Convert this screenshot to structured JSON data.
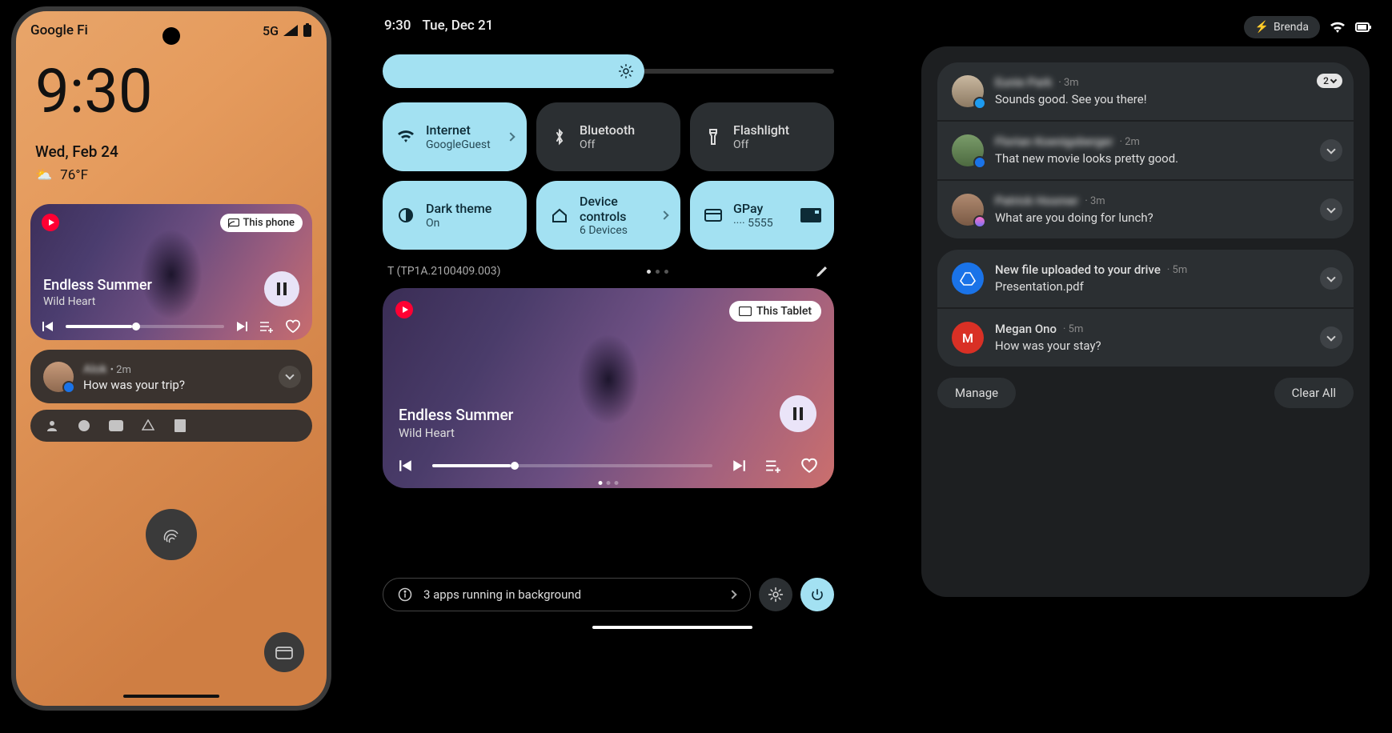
{
  "phone": {
    "carrier": "Google Fi",
    "network": "5G",
    "clock": "9:30",
    "date": "Wed, Feb 24",
    "temp": "76°F",
    "media": {
      "title": "Endless Summer",
      "artist": "Wild Heart",
      "cast_label": "This phone"
    },
    "notif": {
      "name": "Alok",
      "meta": "• 2m",
      "msg": "How was your trip?"
    }
  },
  "tablet": {
    "clock": "9:30",
    "date": "Tue, Dec 21",
    "user": "Brenda",
    "build": "T (TP1A.2100409.003)",
    "bg_apps": "3 apps running in background",
    "tiles": [
      {
        "label": "Internet",
        "sub": "GoogleGuest",
        "state": "on",
        "icon": "wifi",
        "chevron": true
      },
      {
        "label": "Bluetooth",
        "sub": "Off",
        "state": "off",
        "icon": "bluetooth",
        "chevron": false
      },
      {
        "label": "Flashlight",
        "sub": "Off",
        "state": "off",
        "icon": "flashlight",
        "chevron": false
      },
      {
        "label": "Dark theme",
        "sub": "On",
        "state": "on",
        "icon": "darktheme",
        "chevron": false
      },
      {
        "label": "Device controls",
        "sub": "6 Devices",
        "state": "on",
        "icon": "home",
        "chevron": true
      },
      {
        "label": "GPay",
        "sub": "···· 5555",
        "state": "on",
        "icon": "card",
        "chevron": false,
        "trailing_card": true
      }
    ],
    "media": {
      "title": "Endless Summer",
      "artist": "Wild Heart",
      "cast_label": "This Tablet"
    }
  },
  "notifications": {
    "group1": [
      {
        "name": "Eunie Park",
        "meta": "· 3m",
        "msg": "Sounds good. See you there!",
        "avatar": "p1",
        "badge": "tw",
        "count": "2"
      },
      {
        "name": "Florian Koenigsberger",
        "meta": "· 2m",
        "msg": "That new movie looks pretty good.",
        "avatar": "p2",
        "badge": "msg"
      },
      {
        "name": "Patrick Hosmer",
        "meta": "· 3m",
        "msg": "What are you doing for lunch?",
        "avatar": "p3",
        "badge": "fb"
      }
    ],
    "group2": [
      {
        "title": "New file uploaded to your drive",
        "meta": "· 5m",
        "msg": "Presentation.pdf",
        "icon": "drive"
      },
      {
        "title": "Megan Ono",
        "meta": "· 5m",
        "msg": "How was your stay?",
        "icon": "gmail"
      }
    ],
    "manage": "Manage",
    "clear": "Clear All"
  }
}
